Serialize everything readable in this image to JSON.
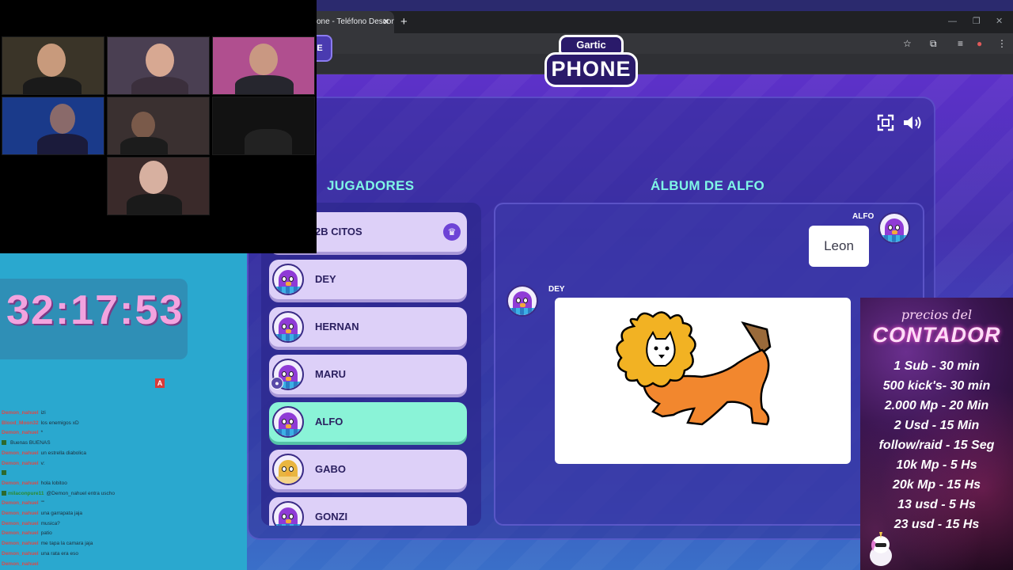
{
  "browser": {
    "tab_title": "one - Teléfono Descon",
    "tab_close": "✕",
    "new_tab": "+",
    "minimize": "—",
    "restore": "❐",
    "close": "✕"
  },
  "game": {
    "menu_label": "E",
    "logo_top": "Gartic",
    "logo_main": "PHONE",
    "players_title": "JUGADORES",
    "album_title": "ÁLBUM DE ALFO",
    "players": [
      {
        "name": "2B CITOS",
        "host": true
      },
      {
        "name": "DEY"
      },
      {
        "name": "HERNAN"
      },
      {
        "name": "MARU",
        "badge": true
      },
      {
        "name": "ALFO",
        "active": true
      },
      {
        "name": "GABO",
        "avatar": "gold"
      },
      {
        "name": "GONZI"
      }
    ],
    "album": {
      "entry1_author": "ALFO",
      "entry1_text": "Leon",
      "entry2_author": "DEY"
    }
  },
  "overlay": {
    "timer": "32:17:53",
    "alert_icon": "A",
    "chat": [
      {
        "user": "Demon_nahuel",
        "msg": "izi"
      },
      {
        "user": "Blood_Moon32",
        "msg": "los enemigos xD"
      },
      {
        "user": "Demon_nahuel",
        "msg": "*"
      },
      {
        "user": "",
        "msg": "Buenas BUENAS",
        "green": true
      },
      {
        "user": "Demon_nahuel",
        "msg": "un estrella diabolica"
      },
      {
        "user": "Demon_nahuel",
        "msg": "v:"
      },
      {
        "user": "",
        "msg": "",
        "green": true
      },
      {
        "user": "Demon_nahuel",
        "msg": "hola lobitoo"
      },
      {
        "user": "milaconpure11",
        "msg": "@Demon_nahuel entra uscho",
        "green": true
      },
      {
        "user": "Demon_nahuel",
        "msg": "\"\""
      },
      {
        "user": "Demon_nahuel",
        "msg": "una garrapata jaja"
      },
      {
        "user": "Demon_nahuel",
        "msg": "musica?"
      },
      {
        "user": "Demon_nahuel",
        "msg": "patio"
      },
      {
        "user": "Demon_nahuel",
        "msg": "me tapa la camara jaja"
      },
      {
        "user": "Demon_nahuel",
        "msg": "una rata era eso"
      },
      {
        "user": "Demon_nahuel",
        "msg": ""
      }
    ]
  },
  "prices": {
    "subtitle": "precios del",
    "title": "CONTADOR",
    "lines": [
      "1 Sub - 30 min",
      "500 kick's- 30 min",
      "2.000 Mp - 20 Min",
      "2 Usd - 15 Min",
      "follow/raid - 15 Seg",
      "10k Mp - 5 Hs",
      "20k Mp - 15 Hs",
      "13 usd - 5 Hs",
      "23 usd - 15 Hs"
    ]
  },
  "colors": {
    "accent_teal": "#7ff6e6",
    "active_player": "#8af3d7",
    "timer_pink": "#f3a3df"
  },
  "icons": [
    "fullscreen-icon",
    "volume-icon",
    "crown-icon",
    "star-icon",
    "extensions-icon"
  ]
}
